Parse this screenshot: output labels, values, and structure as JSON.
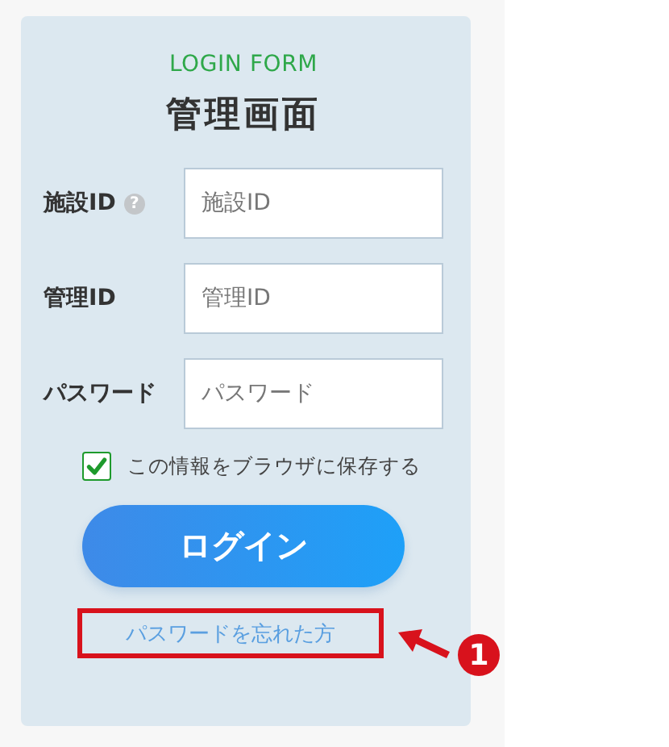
{
  "header": {
    "eyebrow": "LOGIN FORM",
    "title": "管理画面"
  },
  "fields": [
    {
      "label": "施設ID",
      "help": "?",
      "placeholder": "施設ID"
    },
    {
      "label": "管理ID",
      "placeholder": "管理ID"
    },
    {
      "label": "パスワード",
      "placeholder": "パスワード"
    }
  ],
  "remember": {
    "label": "この情報をブラウザに保存する",
    "checked": true
  },
  "login_button": "ログイン",
  "forgot_link": "パスワードを忘れた方",
  "annotation": {
    "number": "1"
  }
}
